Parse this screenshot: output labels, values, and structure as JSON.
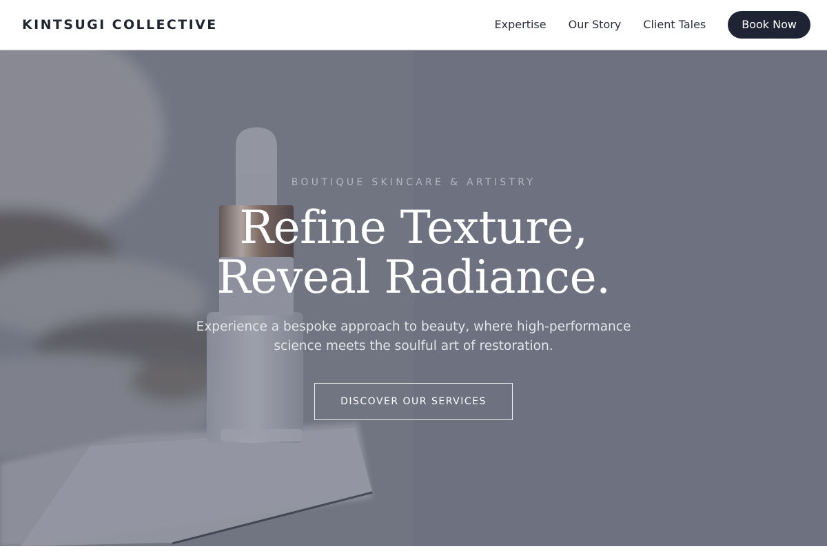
{
  "header": {
    "brand": "KINTSUGI COLLECTIVE",
    "nav": [
      {
        "label": "Expertise"
      },
      {
        "label": "Our Story"
      },
      {
        "label": "Client Tales"
      }
    ],
    "cta_label": "Book Now"
  },
  "hero": {
    "eyebrow": "BOUTIQUE SKINCARE & ARTISTRY",
    "headline_line1": "Refine Texture,",
    "headline_line2": "Reveal Radiance.",
    "lede_line1": "Experience a bespoke approach to beauty, where high-performance",
    "lede_line2": "science meets the soulful art of restoration.",
    "cta_label": "DISCOVER OUR SERVICES"
  },
  "colors": {
    "header_bg": "#ffffff",
    "button_dark": "#1e2433",
    "hero_overlay": "#707584",
    "headline": "#ffffff"
  },
  "icons": {
    "hero_image": "dropper-bottle-photo"
  }
}
